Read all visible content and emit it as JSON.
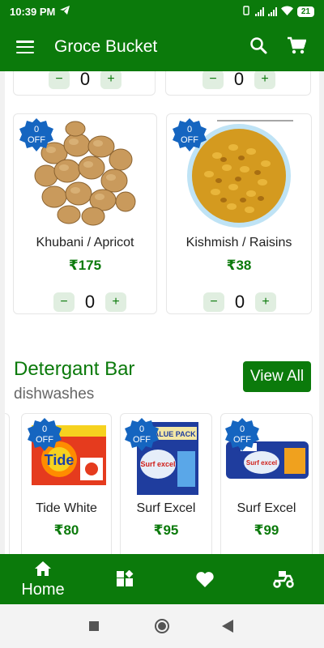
{
  "status_bar": {
    "time": "10:39 PM",
    "battery": "21"
  },
  "app_bar": {
    "title": "Groce Bucket",
    "menu_icon": "hamburger-menu-icon",
    "search_icon": "search-icon",
    "cart_icon": "cart-icon"
  },
  "top_row": {
    "qty_left": "0",
    "qty_right": "0"
  },
  "products": [
    {
      "name": "Khubani / Apricot",
      "price": "₹175",
      "badge_value": "0",
      "badge_label": "OFF",
      "qty": "0"
    },
    {
      "name": "Kishmish / Raisins",
      "price": "₹38",
      "badge_value": "0",
      "badge_label": "OFF",
      "qty": "0"
    }
  ],
  "stepper": {
    "minus": "−",
    "plus": "+"
  },
  "section": {
    "title": "Detergant Bar",
    "subtitle": "dishwashes",
    "view_all": "View All",
    "items": [
      {
        "name": "Tide White",
        "price": "₹80",
        "badge_value": "0",
        "badge_label": "OFF",
        "pack_text": "Tide"
      },
      {
        "name": "Surf Excel",
        "price": "₹95",
        "badge_value": "0",
        "badge_label": "OFF",
        "pack_text": "Surf excel",
        "pack_banner": "VALUE PACK"
      },
      {
        "name": "Surf Excel",
        "price": "₹99",
        "badge_value": "0",
        "badge_label": "OFF",
        "pack_text": "Surf excel"
      }
    ]
  },
  "bottom_nav": {
    "home_label": "Home"
  },
  "colors": {
    "primary": "#0b7a0b",
    "badge": "#1565c0"
  }
}
